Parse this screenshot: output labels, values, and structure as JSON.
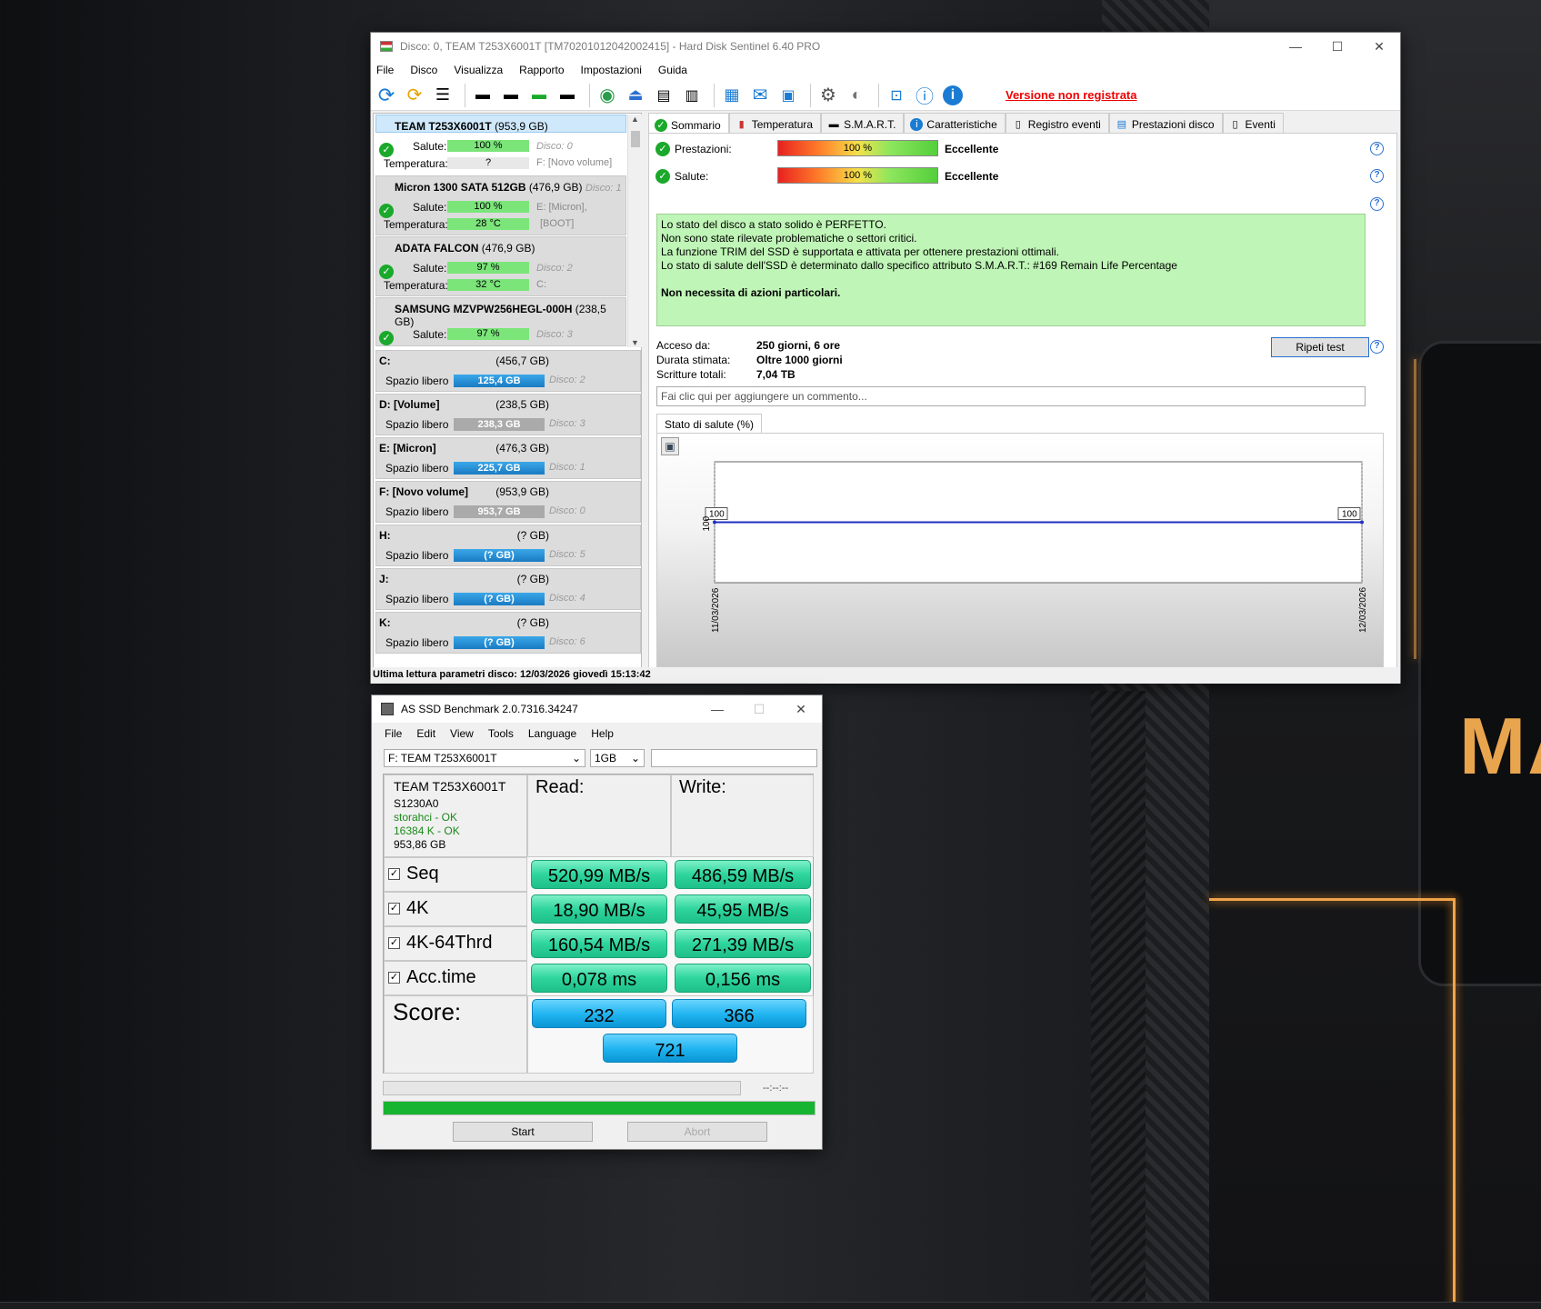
{
  "hds": {
    "title": "Disco: 0, TEAM T253X6001T [TM70201012042002415]  -  Hard Disk Sentinel 6.40 PRO",
    "menu": [
      "File",
      "Disco",
      "Visualizza",
      "Rapporto",
      "Impostazioni",
      "Guida"
    ],
    "unregistered": "Versione non registrata",
    "disks": [
      {
        "name": "TEAM T253X6001T",
        "size": "(953,9 GB)",
        "salute": "100 %",
        "temp": "?",
        "disk_info": "Disco: 0",
        "vol_info": "F: [Novo volume]"
      },
      {
        "name": "Micron 1300 SATA 512GB",
        "size": "(476,9 GB)",
        "disk_label": "Disco: 1",
        "salute": "100 %",
        "temp": "28 °C",
        "vol_info": "E: [Micron],",
        "vol_info2": "[BOOT]"
      },
      {
        "name": "ADATA FALCON",
        "size": "(476,9 GB)",
        "salute": "97 %",
        "temp": "32 °C",
        "disk_info": "Disco: 2",
        "vol_info": "C:"
      },
      {
        "name": "SAMSUNG MZVPW256HEGL-000H",
        "size": "(238,5 GB)",
        "salute": "97 %",
        "disk_info": "Disco: 3"
      }
    ],
    "labels": {
      "salute": "Salute:",
      "temperatura": "Temperatura:",
      "spazio": "Spazio libero"
    },
    "volumes": [
      {
        "name": "C:",
        "size": "(456,7 GB)",
        "free": "125,4 GB",
        "disk": "Disco: 2",
        "blue": true
      },
      {
        "name": "D: [Volume]",
        "size": "(238,5 GB)",
        "free": "238,3 GB",
        "disk": "Disco: 3",
        "blue": false
      },
      {
        "name": "E: [Micron]",
        "size": "(476,3 GB)",
        "free": "225,7 GB",
        "disk": "Disco: 1",
        "blue": true
      },
      {
        "name": "F: [Novo volume]",
        "size": "(953,9 GB)",
        "free": "953,7 GB",
        "disk": "Disco: 0",
        "blue": false
      },
      {
        "name": "H:",
        "size": "(? GB)",
        "free": "(? GB)",
        "disk": "Disco: 5",
        "blue": true
      },
      {
        "name": "J:",
        "size": "(? GB)",
        "free": "(? GB)",
        "disk": "Disco: 4",
        "blue": true
      },
      {
        "name": "K:",
        "size": "(? GB)",
        "free": "(? GB)",
        "disk": "Disco: 6",
        "blue": true
      }
    ],
    "tabs": [
      "Sommario",
      "Temperatura",
      "S.M.A.R.T.",
      "Caratteristiche",
      "Registro eventi",
      "Prestazioni disco",
      "Eventi"
    ],
    "summary": {
      "prestazioni_label": "Prestazioni:",
      "prestazioni_value": "100 %",
      "prestazioni_rating": "Eccellente",
      "salute_label": "Salute:",
      "salute_value": "100 %",
      "salute_rating": "Eccellente",
      "status_lines": [
        "Lo stato del disco a stato solido è PERFETTO.",
        "Non sono state rilevate problematiche o settori critici.",
        "La funzione TRIM del SSD è supportata e attivata per ottenere prestazioni ottimali.",
        "Lo stato di salute dell'SSD è determinato dallo specifico attributo S.M.A.R.T.:  #169 Remain Life Percentage"
      ],
      "status_action": "Non necessita di azioni particolari.",
      "acceso_label": "Acceso da:",
      "acceso_value": "250 giorni, 6 ore",
      "durata_label": "Durata stimata:",
      "durata_value": "Oltre 1000 giorni",
      "scritture_label": "Scritture totali:",
      "scritture_value": "7,04 TB",
      "repeat_button": "Ripeti test",
      "comment_placeholder": "Fai clic qui per aggiungere un commento..."
    },
    "chart_tab": "Stato di salute (%)",
    "status_bar": "Ultima lettura parametri disco: 12/03/2026 giovedì 15:13:42"
  },
  "chart_data": {
    "type": "line",
    "x": [
      "11/03/2026",
      "12/03/2026"
    ],
    "series": [
      {
        "values": [
          100,
          100
        ]
      }
    ],
    "ytick": "100",
    "point_labels": [
      "100",
      "100"
    ]
  },
  "asssd": {
    "title": "AS SSD Benchmark 2.0.7316.34247",
    "menu": [
      "File",
      "Edit",
      "View",
      "Tools",
      "Language",
      "Help"
    ],
    "drive_select": "F: TEAM T253X6001T",
    "size_select": "1GB",
    "info": {
      "model": "TEAM T253X6001T",
      "firmware": "S1230A0",
      "driver": "storahci - OK",
      "align": "16384 K - OK",
      "capacity": "953,86 GB"
    },
    "read_label": "Read:",
    "write_label": "Write:",
    "rows": [
      {
        "name": "Seq",
        "read": "520,99 MB/s",
        "write": "486,59 MB/s"
      },
      {
        "name": "4K",
        "read": "18,90 MB/s",
        "write": "45,95 MB/s"
      },
      {
        "name": "4K-64Thrd",
        "read": "160,54 MB/s",
        "write": "271,39 MB/s"
      },
      {
        "name": "Acc.time",
        "read": "0,078 ms",
        "write": "0,156 ms"
      }
    ],
    "score_label": "Score:",
    "score_read": "232",
    "score_write": "366",
    "score_total": "721",
    "time": "--:--:--",
    "progress": 1.0,
    "start": "Start",
    "abort": "Abort"
  },
  "colors": {
    "accent_orange": "#f0a54a",
    "unreg_red": "#e00000",
    "ok_green": "#1aa92b"
  }
}
